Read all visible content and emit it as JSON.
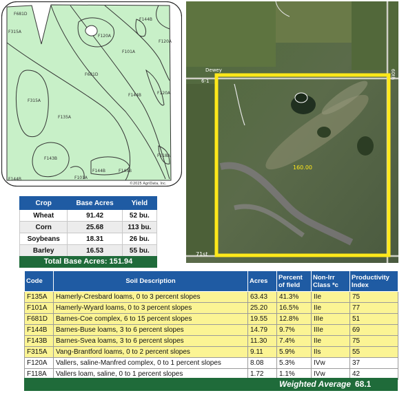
{
  "soil_map": {
    "labels": [
      "F681D",
      "F315A",
      "F120A",
      "F144B",
      "F120A",
      "F101A",
      "F681D",
      "F144B",
      "F120A",
      "F315A",
      "F135A",
      "F143B",
      "F144B",
      "F143B",
      "F118A",
      "F101A",
      "F144B"
    ],
    "copyright": "©2025 AgriData, Inc."
  },
  "satellite": {
    "road_north": "Dewey",
    "road_west": "6-1",
    "road_east": "60th",
    "road_south": "71st",
    "field_acres": "160.00"
  },
  "crop_table": {
    "headers": [
      "Crop",
      "Base Acres",
      "Yield"
    ],
    "rows": [
      {
        "crop": "Wheat",
        "base_acres": "91.42",
        "yield": "52 bu."
      },
      {
        "crop": "Corn",
        "base_acres": "25.68",
        "yield": "113 bu."
      },
      {
        "crop": "Soybeans",
        "base_acres": "18.31",
        "yield": "26 bu."
      },
      {
        "crop": "Barley",
        "base_acres": "16.53",
        "yield": "55 bu."
      }
    ],
    "total_label": "Total Base Acres:",
    "total_value": "151.94"
  },
  "soil_table": {
    "headers": {
      "code": "Code",
      "desc": "Soil Description",
      "acres": "Acres",
      "pct": "Percent of field",
      "class": "Non-Irr Class *c",
      "prod": "Productivity Index"
    },
    "rows": [
      {
        "code": "F135A",
        "desc": "Hamerly-Cresbard loams, 0 to 3 percent slopes",
        "acres": "63.43",
        "pct": "41.3%",
        "class": "IIe",
        "prod": "75",
        "highlight": true
      },
      {
        "code": "F101A",
        "desc": "Hamerly-Wyard loams, 0 to 3 percent slopes",
        "acres": "25.20",
        "pct": "16.5%",
        "class": "IIe",
        "prod": "77",
        "highlight": true
      },
      {
        "code": "F681D",
        "desc": "Barnes-Coe complex, 6 to 15 percent slopes",
        "acres": "19.55",
        "pct": "12.8%",
        "class": "IIIe",
        "prod": "51",
        "highlight": true
      },
      {
        "code": "F144B",
        "desc": "Barnes-Buse loams, 3 to 6 percent slopes",
        "acres": "14.79",
        "pct": "9.7%",
        "class": "IIIe",
        "prod": "69",
        "highlight": true
      },
      {
        "code": "F143B",
        "desc": "Barnes-Svea loams, 3 to 6 percent slopes",
        "acres": "11.30",
        "pct": "7.4%",
        "class": "IIe",
        "prod": "75",
        "highlight": true
      },
      {
        "code": "F315A",
        "desc": "Vang-Brantford loams, 0 to 2 percent slopes",
        "acres": "9.11",
        "pct": "5.9%",
        "class": "IIs",
        "prod": "55",
        "highlight": true
      },
      {
        "code": "F120A",
        "desc": "Vallers, saline-Manfred complex, 0 to 1 percent slopes",
        "acres": "8.08",
        "pct": "5.3%",
        "class": "IVw",
        "prod": "37",
        "highlight": false
      },
      {
        "code": "F118A",
        "desc": "Vallers loam, saline, 0 to 1 percent slopes",
        "acres": "1.72",
        "pct": "1.1%",
        "class": "IVw",
        "prod": "42",
        "highlight": false
      }
    ],
    "weighted_average_label": "Weighted Average",
    "weighted_average_value": "68.1"
  },
  "colors": {
    "header_blue": "#1f5ba3",
    "total_green": "#1f6b3a",
    "highlight_yellow": "#fbf494",
    "map_green": "#c8f0c8",
    "field_outline_yellow": "#ffe81a"
  }
}
